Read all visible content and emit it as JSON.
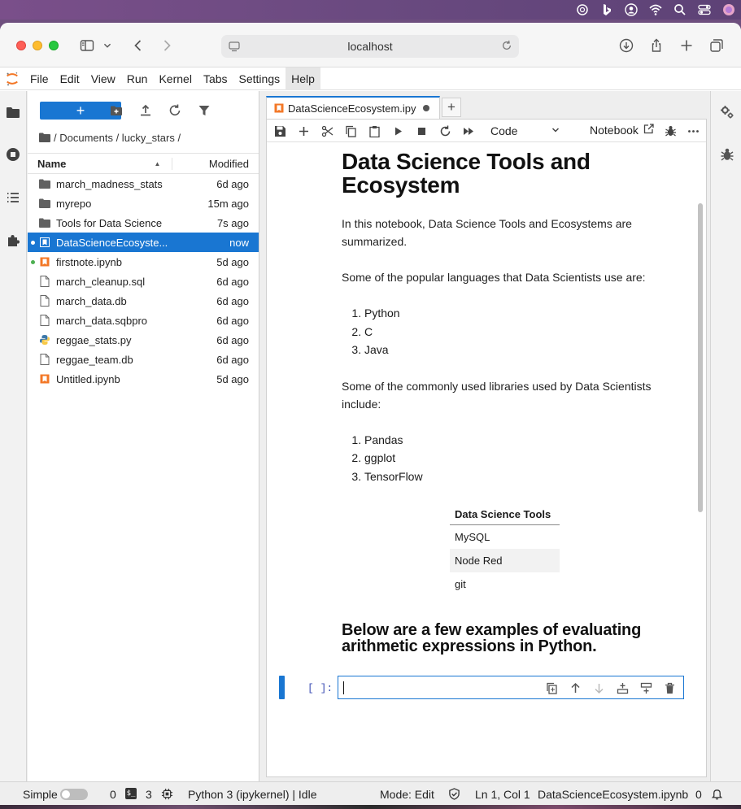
{
  "browser": {
    "address": "localhost"
  },
  "menu": {
    "items": [
      "File",
      "Edit",
      "View",
      "Run",
      "Kernel",
      "Tabs",
      "Settings",
      "Help"
    ],
    "active": "Help"
  },
  "filebrowser": {
    "breadcrumb": "/ Documents / lucky_stars /",
    "header_name": "Name",
    "header_modified": "Modified",
    "files": [
      {
        "name": "march_madness_stats",
        "modified": "6d ago",
        "type": "folder",
        "dot": ""
      },
      {
        "name": "myrepo",
        "modified": "15m ago",
        "type": "folder",
        "dot": ""
      },
      {
        "name": "Tools for Data Science",
        "modified": "7s ago",
        "type": "folder",
        "dot": ""
      },
      {
        "name": "DataScienceEcosyste...",
        "modified": "now",
        "type": "notebook",
        "dot": "white",
        "selected": true
      },
      {
        "name": "firstnote.ipynb",
        "modified": "5d ago",
        "type": "notebook",
        "dot": "green"
      },
      {
        "name": "march_cleanup.sql",
        "modified": "6d ago",
        "type": "file",
        "dot": ""
      },
      {
        "name": "march_data.db",
        "modified": "6d ago",
        "type": "file",
        "dot": ""
      },
      {
        "name": "march_data.sqbpro",
        "modified": "6d ago",
        "type": "file",
        "dot": ""
      },
      {
        "name": "reggae_stats.py",
        "modified": "6d ago",
        "type": "python",
        "dot": ""
      },
      {
        "name": "reggae_team.db",
        "modified": "6d ago",
        "type": "file",
        "dot": ""
      },
      {
        "name": "Untitled.ipynb",
        "modified": "5d ago",
        "type": "notebook",
        "dot": ""
      }
    ]
  },
  "notebook": {
    "tab_title": "DataScienceEcosystem.ipy",
    "cell_type": "Code",
    "kernel_label": "Notebook",
    "title": "Data Science Tools and Ecosystem",
    "intro": "In this notebook, Data Science Tools and Ecosystems are summarized.",
    "languages_intro": "Some of the popular languages that Data Scientists use are:",
    "languages": [
      "Python",
      "C",
      "Java"
    ],
    "libraries_intro": "Some of the commonly used libraries used by Data Scientists include:",
    "libraries": [
      "Pandas",
      "ggplot",
      "TensorFlow"
    ],
    "table_header": "Data Science Tools",
    "table_rows": [
      "MySQL",
      "Node Red",
      "git"
    ],
    "examples_heading": "Below are a few examples of evaluating arithmetic expressions in Python.",
    "prompt": "[ ]:"
  },
  "statusbar": {
    "mode_simple": "Simple",
    "count_a": "0",
    "count_b": "3",
    "kernel": "Python 3 (ipykernel) | Idle",
    "mode": "Mode: Edit",
    "cursor": "Ln 1, Col 1",
    "filename": "DataScienceEcosystem.ipynb",
    "notifications": "0"
  },
  "colors": {
    "accent": "#1976d2",
    "notebook_icon": "#f37726"
  }
}
